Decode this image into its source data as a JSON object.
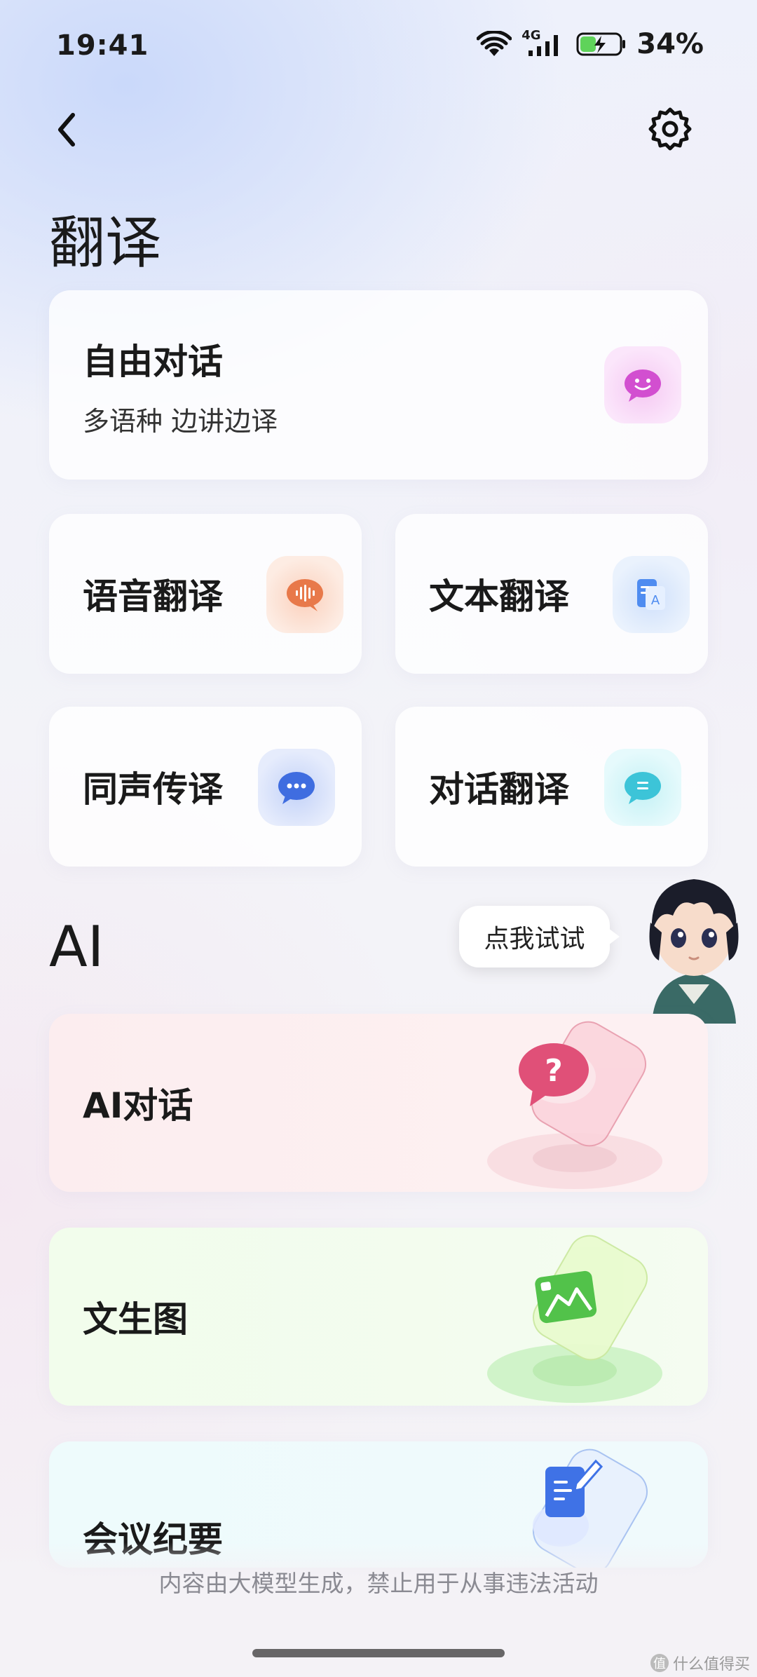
{
  "status_bar": {
    "time": "19:41",
    "network": "4G",
    "battery": "34%"
  },
  "header": {
    "back_icon": "chevron-left-icon",
    "settings_icon": "gear-icon"
  },
  "translate_section": {
    "title": "翻译",
    "free_dialogue": {
      "title": "自由对话",
      "subtitle": "多语种 边讲边译",
      "icon": "smile-chat-icon",
      "accent": "#d65ad6"
    },
    "tiles": [
      {
        "title": "语音翻译",
        "icon": "voice-wave-icon",
        "accent": "#e8794a"
      },
      {
        "title": "文本翻译",
        "icon": "text-translate-icon",
        "accent": "#4f8cf0"
      },
      {
        "title": "同声传译",
        "icon": "chat-dots-icon",
        "accent": "#3f6de0"
      },
      {
        "title": "对话翻译",
        "icon": "dialog-bubble-icon",
        "accent": "#3cc4d8"
      }
    ]
  },
  "ai_section": {
    "title": "AI",
    "features": [
      {
        "title": "AI对话",
        "icon": "question-bubble-icon",
        "accent": "#e05078"
      },
      {
        "title": "文生图",
        "icon": "image-card-icon",
        "accent": "#52c24a"
      },
      {
        "title": "会议纪要",
        "icon": "document-edit-icon",
        "accent": "#3f72e6"
      }
    ]
  },
  "assistant": {
    "tooltip": "点我试试",
    "avatar": "boy-avatar"
  },
  "footer": {
    "disclaimer": "内容由大模型生成，禁止用于从事违法活动",
    "watermark": "什么值得买",
    "watermark_badge": "值"
  }
}
